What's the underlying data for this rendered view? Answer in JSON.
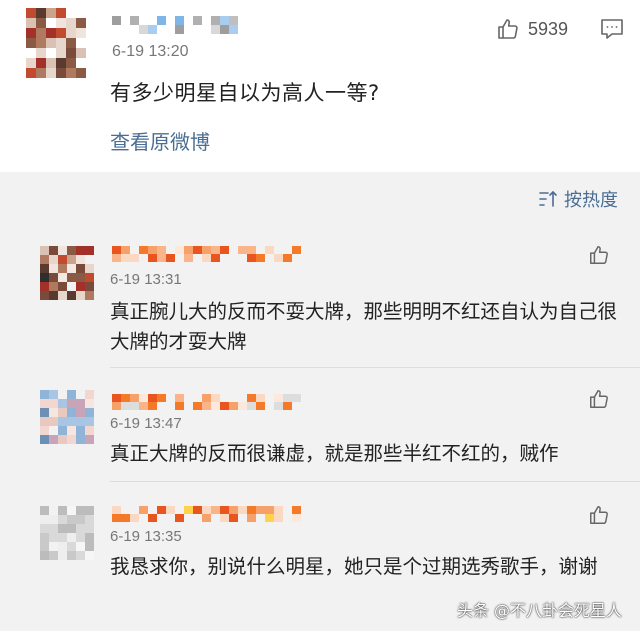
{
  "post": {
    "time": "6-19 13:20",
    "like_count": "5939",
    "text": "有多少明星自以为高人一等?",
    "view_original": "查看原微博"
  },
  "sort": {
    "label": "按热度"
  },
  "comments": [
    {
      "time": "6-19 13:31",
      "text": "真正腕儿大的反而不耍大牌，那些明明不红还自认为自己很大牌的才耍大牌"
    },
    {
      "time": "6-19 13:47",
      "text": "真正大牌的反而很谦虚，就是那些半红不红的，贼作"
    },
    {
      "time": "6-19 13:35",
      "text": "我恳求你，别说什么明星，她只是个过期选秀歌手，谢谢"
    }
  ],
  "watermark": "头条 @不八卦会死星人",
  "colors": {
    "link": "#4a6e93",
    "background": "#f2f2f2",
    "card": "#ffffff"
  }
}
